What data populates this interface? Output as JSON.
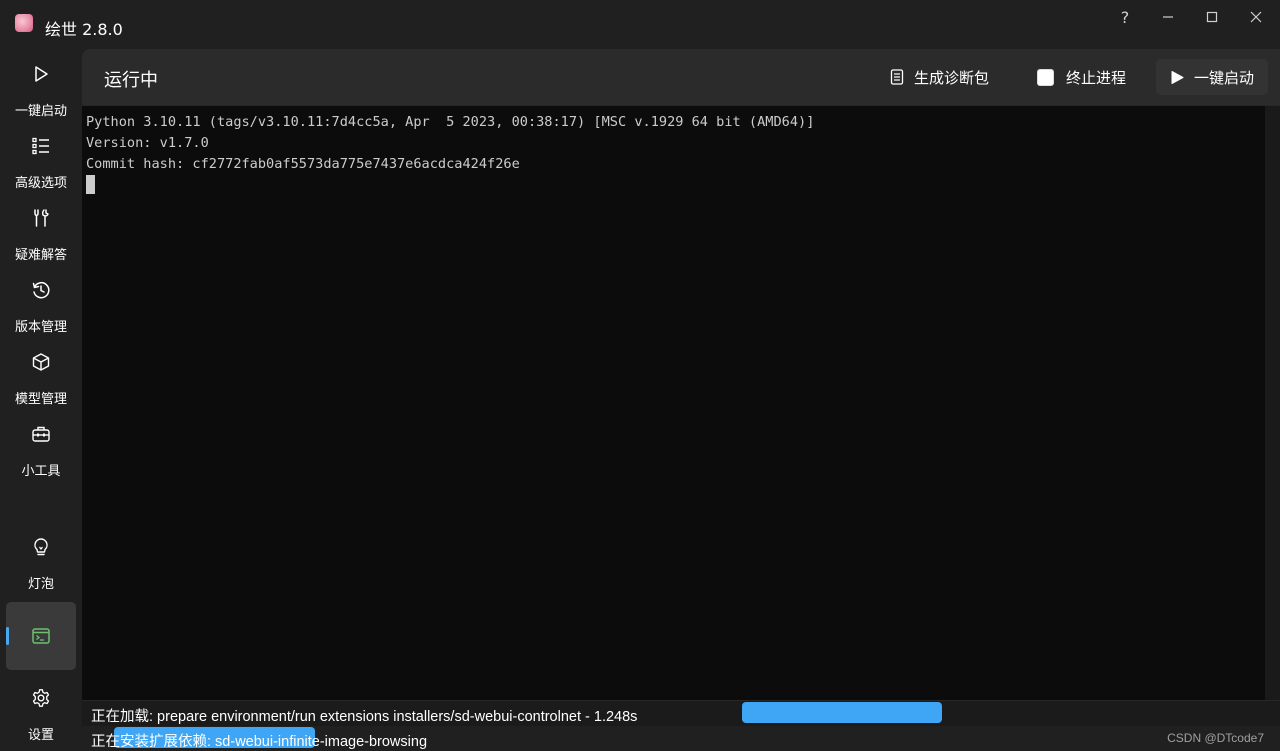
{
  "window": {
    "title": "绘世 2.8.0",
    "help_label": "?",
    "accent_color": "#4aa8f0"
  },
  "sidebar": {
    "items": [
      {
        "label": "一键启动",
        "icon": "play-icon"
      },
      {
        "label": "高级选项",
        "icon": "list-icon"
      },
      {
        "label": "疑难解答",
        "icon": "tools-icon"
      },
      {
        "label": "版本管理",
        "icon": "history-icon"
      },
      {
        "label": "模型管理",
        "icon": "cube-icon"
      },
      {
        "label": "小工具",
        "icon": "toolbox-icon"
      }
    ],
    "bottom_items": [
      {
        "label": "灯泡",
        "icon": "lightbulb-icon"
      },
      {
        "label": "",
        "icon": "terminal-icon",
        "active": true
      },
      {
        "label": "设置",
        "icon": "gear-icon"
      }
    ]
  },
  "header": {
    "title": "运行中",
    "diag_label": "生成诊断包",
    "terminate_label": "终止进程",
    "start_label": "一键启动"
  },
  "terminal": {
    "lines": [
      "Python 3.10.11 (tags/v3.10.11:7d4cc5a, Apr  5 2023, 00:38:17) [MSC v.1929 64 bit (AMD64)]",
      "Version: v1.7.0",
      "Commit hash: cf2772fab0af5573da775e7437e6acdca424f26e"
    ],
    "background": "#0c0c0c",
    "text_color": "#cccccc"
  },
  "status": {
    "line1": "正在加载: prepare environment/run extensions installers/sd-webui-controlnet - 1.248s",
    "line2": "正在安装扩展依赖: sd-webui-infinite-image-browsing",
    "progress_color": "#3ea6f5",
    "watermark": "CSDN @DTcode7"
  }
}
